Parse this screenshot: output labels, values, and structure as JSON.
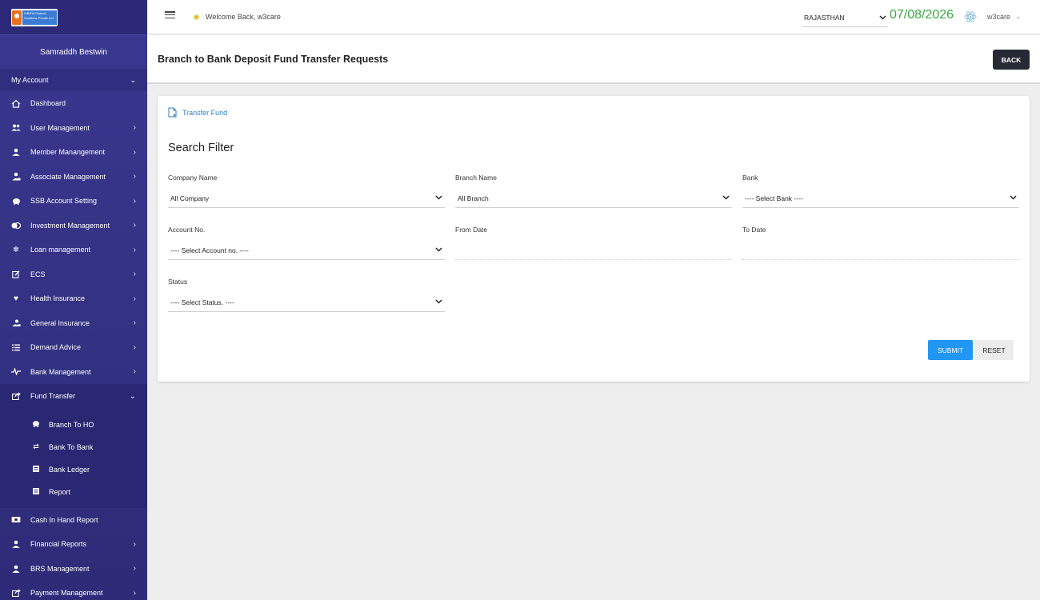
{
  "sidebar": {
    "logo_text": "SIBIFA Finance Solutions Private Ltd",
    "user_name": "Samraddh Bestwin",
    "my_account": "My Account",
    "items": [
      {
        "label": "Dashboard",
        "icon": "home-icon"
      },
      {
        "label": "User Management",
        "icon": "users-icon"
      },
      {
        "label": "Member Manangement",
        "icon": "user-icon"
      },
      {
        "label": "Associate Management",
        "icon": "user-tie-icon"
      },
      {
        "label": "SSB Account Setting",
        "icon": "piggy-bank-icon"
      },
      {
        "label": "Investment Management",
        "icon": "coins-icon"
      },
      {
        "label": "Loan management",
        "icon": "snowflake-icon"
      },
      {
        "label": "ECS",
        "icon": "edit-icon"
      },
      {
        "label": "Health Insurance",
        "icon": "heart-icon"
      },
      {
        "label": "General Insurance",
        "icon": "hand-holding-icon"
      },
      {
        "label": "Demand Advice",
        "icon": "list-icon"
      },
      {
        "label": "Bank Management",
        "icon": "pulse-icon"
      },
      {
        "label": "Fund Transfer",
        "icon": "share-icon"
      }
    ],
    "fund_transfer_sub": [
      {
        "label": "Branch To HO",
        "icon": "piggy-bank-icon"
      },
      {
        "label": "Bank To Bank",
        "icon": "exchange-icon"
      },
      {
        "label": "Bank Ledger",
        "icon": "ledger-icon"
      },
      {
        "label": "Report",
        "icon": "report-icon"
      }
    ],
    "items_after": [
      {
        "label": "Cash In Hand Report",
        "icon": "cash-icon"
      },
      {
        "label": "Financial Reports",
        "icon": "user-icon"
      },
      {
        "label": "BRS Management",
        "icon": "user-icon"
      },
      {
        "label": "Payment Management",
        "icon": "share-icon"
      }
    ]
  },
  "topbar": {
    "welcome": "Welcome Back, w3care",
    "state": "RAJASTHAN",
    "date": "07/08/2026",
    "user": "w3care"
  },
  "header": {
    "title": "Branch to Bank Deposit Fund Transfer Requests",
    "back": "BACK"
  },
  "card": {
    "transfer_link": "Transfer Fund",
    "filter_title": "Search Filter",
    "company_label": "Company Name",
    "company_value": "All Company",
    "branch_label": "Branch Name",
    "branch_value": "All Branch",
    "bank_label": "Bank",
    "bank_value": "---- Select Bank ----",
    "account_label": "Account No.",
    "account_value": "---- Select Account no. ----",
    "from_label": "From Date",
    "to_label": "To Date",
    "status_label": "Status",
    "status_value": "---- Select Status. ----",
    "submit": "SUBMIT",
    "reset": "RESET"
  },
  "colors": {
    "sidebar_bg": "#3a3890",
    "date_green": "#3aa843",
    "submit_blue": "#2196f3",
    "back_dark": "#252a35",
    "link_blue": "#2f7fc1"
  }
}
